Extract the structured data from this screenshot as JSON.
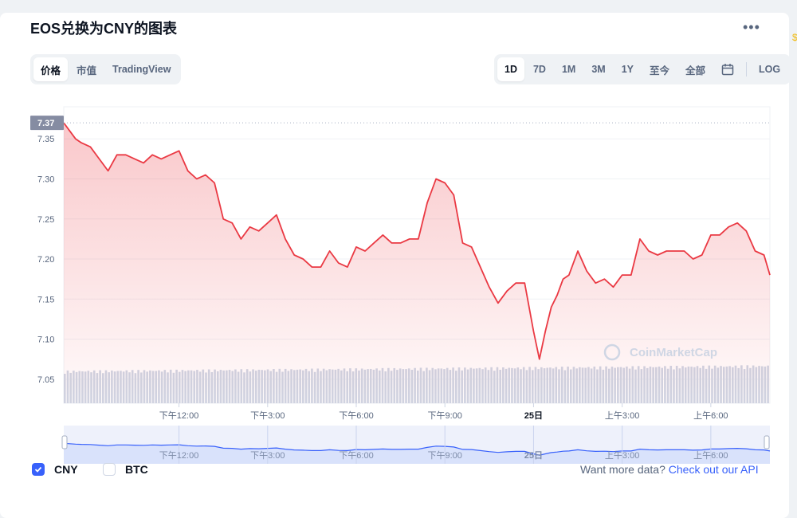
{
  "title": "EOS兑换为CNY的图表",
  "more_icon": "more-horizontal-icon",
  "left_tabs": [
    {
      "label": "价格",
      "active": true
    },
    {
      "label": "市值",
      "active": false
    },
    {
      "label": "TradingView",
      "active": false
    }
  ],
  "range_tabs": [
    {
      "label": "1D",
      "active": true
    },
    {
      "label": "7D",
      "active": false
    },
    {
      "label": "1M",
      "active": false
    },
    {
      "label": "3M",
      "active": false
    },
    {
      "label": "1Y",
      "active": false
    },
    {
      "label": "至今",
      "active": false
    },
    {
      "label": "全部",
      "active": false
    }
  ],
  "calendar_icon": "calendar-icon",
  "log_label": "LOG",
  "chart_data": {
    "type": "area",
    "current_price_label": "7.37",
    "ylim": [
      7.02,
      7.39
    ],
    "y_ticks": [
      "7.35",
      "7.30",
      "7.25",
      "7.20",
      "7.15",
      "7.10",
      "7.05"
    ],
    "x_ticks": [
      "下午12:00",
      "下午3:00",
      "下午6:00",
      "下午9:00",
      "25日",
      "上午3:00",
      "上午6:00"
    ],
    "x_tick_hours": [
      12,
      15,
      18,
      21,
      24,
      27,
      30
    ],
    "x_range_hours": [
      8.1,
      32.0
    ],
    "series": [
      {
        "values_x_hours": [
          8.1,
          8.3,
          8.5,
          8.7,
          9.0,
          9.3,
          9.6,
          9.9,
          10.2,
          10.5,
          10.8,
          11.1,
          11.4,
          11.7,
          12.0,
          12.3,
          12.6,
          12.9,
          13.2,
          13.5,
          13.8,
          14.1,
          14.4,
          14.7,
          15.0,
          15.3,
          15.6,
          15.9,
          16.2,
          16.5,
          16.8,
          17.1,
          17.4,
          17.7,
          18.0,
          18.3,
          18.6,
          18.9,
          19.2,
          19.5,
          19.8,
          20.1,
          20.4,
          20.7,
          21.0,
          21.3,
          21.6,
          21.9,
          22.2,
          22.5,
          22.8,
          23.1,
          23.4,
          23.7,
          24.0,
          24.2,
          24.4,
          24.6,
          24.8,
          25.0,
          25.2,
          25.5,
          25.8,
          26.1,
          26.4,
          26.7,
          27.0,
          27.3,
          27.6,
          27.9,
          28.2,
          28.5,
          28.8,
          29.1,
          29.4,
          29.7,
          30.0,
          30.3,
          30.6,
          30.9,
          31.2,
          31.5,
          31.8,
          32.0
        ],
        "values": [
          7.37,
          7.36,
          7.35,
          7.345,
          7.34,
          7.325,
          7.31,
          7.33,
          7.33,
          7.325,
          7.32,
          7.33,
          7.325,
          7.33,
          7.335,
          7.31,
          7.3,
          7.305,
          7.295,
          7.25,
          7.245,
          7.225,
          7.24,
          7.235,
          7.245,
          7.255,
          7.225,
          7.205,
          7.2,
          7.19,
          7.19,
          7.21,
          7.195,
          7.19,
          7.215,
          7.21,
          7.22,
          7.23,
          7.22,
          7.22,
          7.225,
          7.225,
          7.27,
          7.3,
          7.295,
          7.28,
          7.22,
          7.215,
          7.19,
          7.165,
          7.145,
          7.16,
          7.17,
          7.17,
          7.11,
          7.075,
          7.11,
          7.14,
          7.155,
          7.175,
          7.18,
          7.21,
          7.185,
          7.17,
          7.175,
          7.165,
          7.18,
          7.18,
          7.225,
          7.21,
          7.205,
          7.21,
          7.21,
          7.21,
          7.2,
          7.205,
          7.23,
          7.23,
          7.24,
          7.245,
          7.235,
          7.21,
          7.205,
          7.18
        ]
      }
    ],
    "volume_level": [
      0.6,
      0.7
    ],
    "watermark": "CoinMarketCap"
  },
  "legend": [
    {
      "label": "CNY",
      "checked": true
    },
    {
      "label": "BTC",
      "checked": false
    }
  ],
  "footer": {
    "want_text": "Want more data?",
    "api_link": "Check out our API"
  },
  "colors": {
    "line": "#ea3943",
    "fill_top": "#f6c5c8",
    "accent": "#3861fb",
    "volume": "#cfd6e4",
    "nav_fill": "#d9e2fb",
    "nav_line": "#3861fb"
  }
}
